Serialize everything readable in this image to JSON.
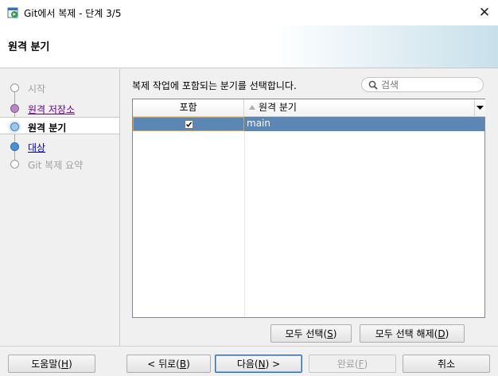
{
  "window": {
    "title": "Git에서 복제 - 단계 3/5",
    "close_glyph": "✕"
  },
  "header": {
    "title": "원격 분기"
  },
  "steps": [
    {
      "label": "시작",
      "state": "disabled"
    },
    {
      "label": "원격 저장소",
      "state": "visited"
    },
    {
      "label": "원격 분기",
      "state": "current"
    },
    {
      "label": "대상",
      "state": "link"
    },
    {
      "label": "Git 복제 요약",
      "state": "disabled"
    }
  ],
  "content": {
    "instruction": "복제 작업에 포함되는 분기를 선택합니다.",
    "search_placeholder": "검색"
  },
  "table": {
    "columns": [
      "포함",
      "원격 분기"
    ],
    "rows": [
      {
        "include": true,
        "branch": "main",
        "selected": true
      }
    ]
  },
  "actions": {
    "select_all": "모두 선택(",
    "select_all_key": "S",
    "deselect_all": "모두 선택 해제(",
    "deselect_all_key": "D"
  },
  "footer": {
    "help": "도움말(",
    "help_key": "H",
    "back": "< 뒤로(",
    "back_key": "B",
    "next": "다음(",
    "next_key": "N",
    "next_suffix": ") >",
    "finish": "완료(",
    "finish_key": "F",
    "cancel": "취소",
    "close_paren": ")"
  },
  "colors": {
    "selection": "#5b86b6",
    "visited_link": "#660099",
    "link": "#0000cc"
  }
}
